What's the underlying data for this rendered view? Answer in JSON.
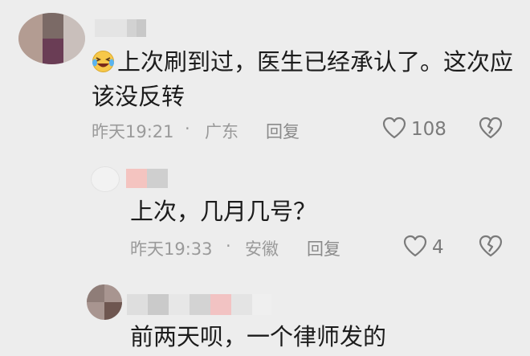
{
  "comments": [
    {
      "emoji": "laughing-crying-emoji",
      "text_line1": "上次刷到过，医生已经承认了。这次应",
      "text_line2": "该没反转",
      "time": "昨天19:21",
      "separator": "·",
      "location": "广东",
      "reply_label": "回复",
      "likes": "108"
    },
    {
      "text": "上次，几月几号？",
      "time": "昨天19:33",
      "separator": "·",
      "location": "安徽",
      "reply_label": "回复",
      "likes": "4"
    },
    {
      "text": "前两天呗，一个律师发的"
    }
  ],
  "colors": {
    "background": "#ededed",
    "text": "#1c1c1c",
    "meta": "#9a9a9a",
    "icon": "#7a7a7a",
    "emoji_face": "#f7c84a"
  }
}
